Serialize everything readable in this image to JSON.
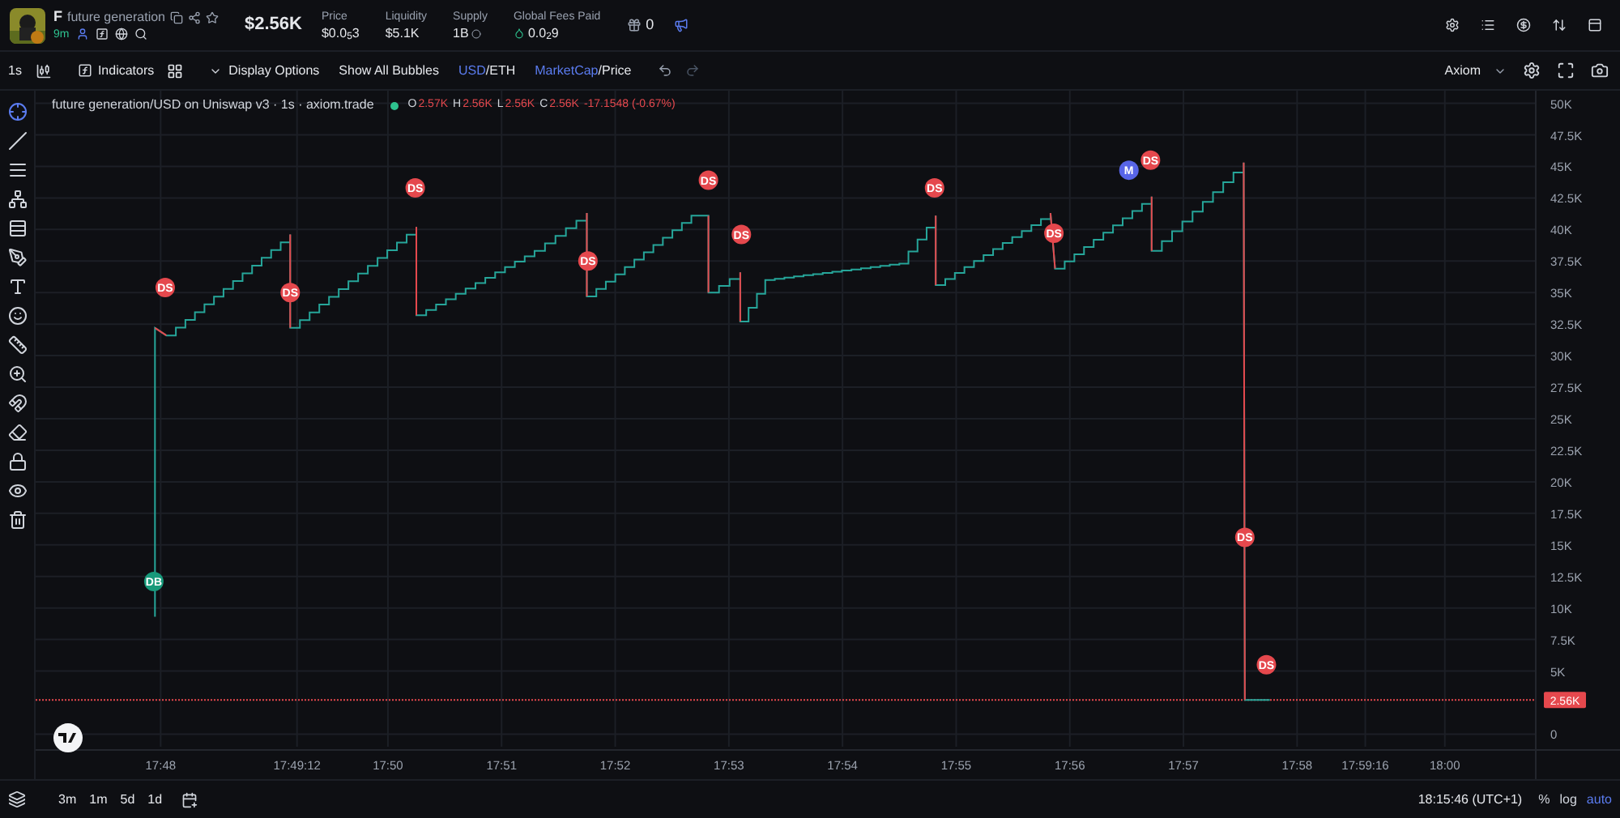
{
  "header": {
    "symbol": "F",
    "name": "future generation",
    "age": "9m",
    "market_cap": "$2.56K",
    "stats": [
      {
        "label": "Price",
        "value": "$0.0$_{5}$3",
        "kind": "plain"
      },
      {
        "label": "Liquidity",
        "value": "$5.1K",
        "kind": "plain"
      },
      {
        "label": "Supply",
        "value": "1B",
        "kind": "supply"
      },
      {
        "label": "Global Fees Paid",
        "value": "0.0$_{2}$9",
        "kind": "fees"
      }
    ],
    "watchers": "0"
  },
  "toolbar": {
    "interval": "1s",
    "indicators": "Indicators",
    "display_options": "Display Options",
    "bubbles": "Show All Bubbles",
    "separator": "/",
    "currency": [
      {
        "label": "USD",
        "selected": true
      },
      {
        "label": "ETH",
        "selected": false
      }
    ],
    "metric": [
      {
        "label": "MarketCap",
        "selected": true
      },
      {
        "label": "Price",
        "selected": false
      }
    ],
    "layout": "Axiom"
  },
  "legend": {
    "title": "future generation/USD on Uniswap v3 · 1s · axiom.trade",
    "ohlc": [
      {
        "label": "O",
        "value": "2.57K"
      },
      {
        "label": "H",
        "value": "2.56K"
      },
      {
        "label": "L",
        "value": "2.56K"
      },
      {
        "label": "C",
        "value": "2.56K"
      }
    ],
    "change": "-17.1548 (-0.67%)"
  },
  "chart": {
    "price_label": "2.56K",
    "y_labels": [
      "50K",
      "47.5K",
      "45K",
      "42.5K",
      "40K",
      "37.5K",
      "35K",
      "32.5K",
      "30K",
      "27.5K",
      "25K",
      "22.5K",
      "20K",
      "17.5K",
      "15K",
      "12.5K",
      "10K",
      "7.5K",
      "5K",
      "0"
    ],
    "time_labels": [
      "17:48",
      "17:49:12",
      "17:50",
      "17:51",
      "17:52",
      "17:53",
      "17:54",
      "17:55",
      "17:56",
      "17:57",
      "17:58",
      "17:59:16",
      "18:00"
    ],
    "bubbles": [
      {
        "label": "DB",
        "color": "#17997a"
      },
      {
        "label": "DS",
        "color": "#e5484d"
      },
      {
        "label": "DS",
        "color": "#e5484d"
      },
      {
        "label": "DS",
        "color": "#e5484d"
      },
      {
        "label": "DS",
        "color": "#e5484d"
      },
      {
        "label": "DS",
        "color": "#e5484d"
      },
      {
        "label": "DS",
        "color": "#e5484d"
      },
      {
        "label": "DS",
        "color": "#e5484d"
      },
      {
        "label": "DS",
        "color": "#e5484d"
      },
      {
        "label": "M",
        "color": "#5865e8"
      },
      {
        "label": "DS",
        "color": "#e5484d"
      },
      {
        "label": "DS",
        "color": "#e5484d"
      },
      {
        "label": "DS",
        "color": "#e5484d"
      }
    ]
  },
  "bottom": {
    "ranges": [
      "3m",
      "1m",
      "5d",
      "1d"
    ],
    "time": "18:15:46 (UTC+1)",
    "options": [
      {
        "label": "%",
        "selected": false
      },
      {
        "label": "log",
        "selected": false
      },
      {
        "label": "auto",
        "selected": true
      }
    ]
  }
}
